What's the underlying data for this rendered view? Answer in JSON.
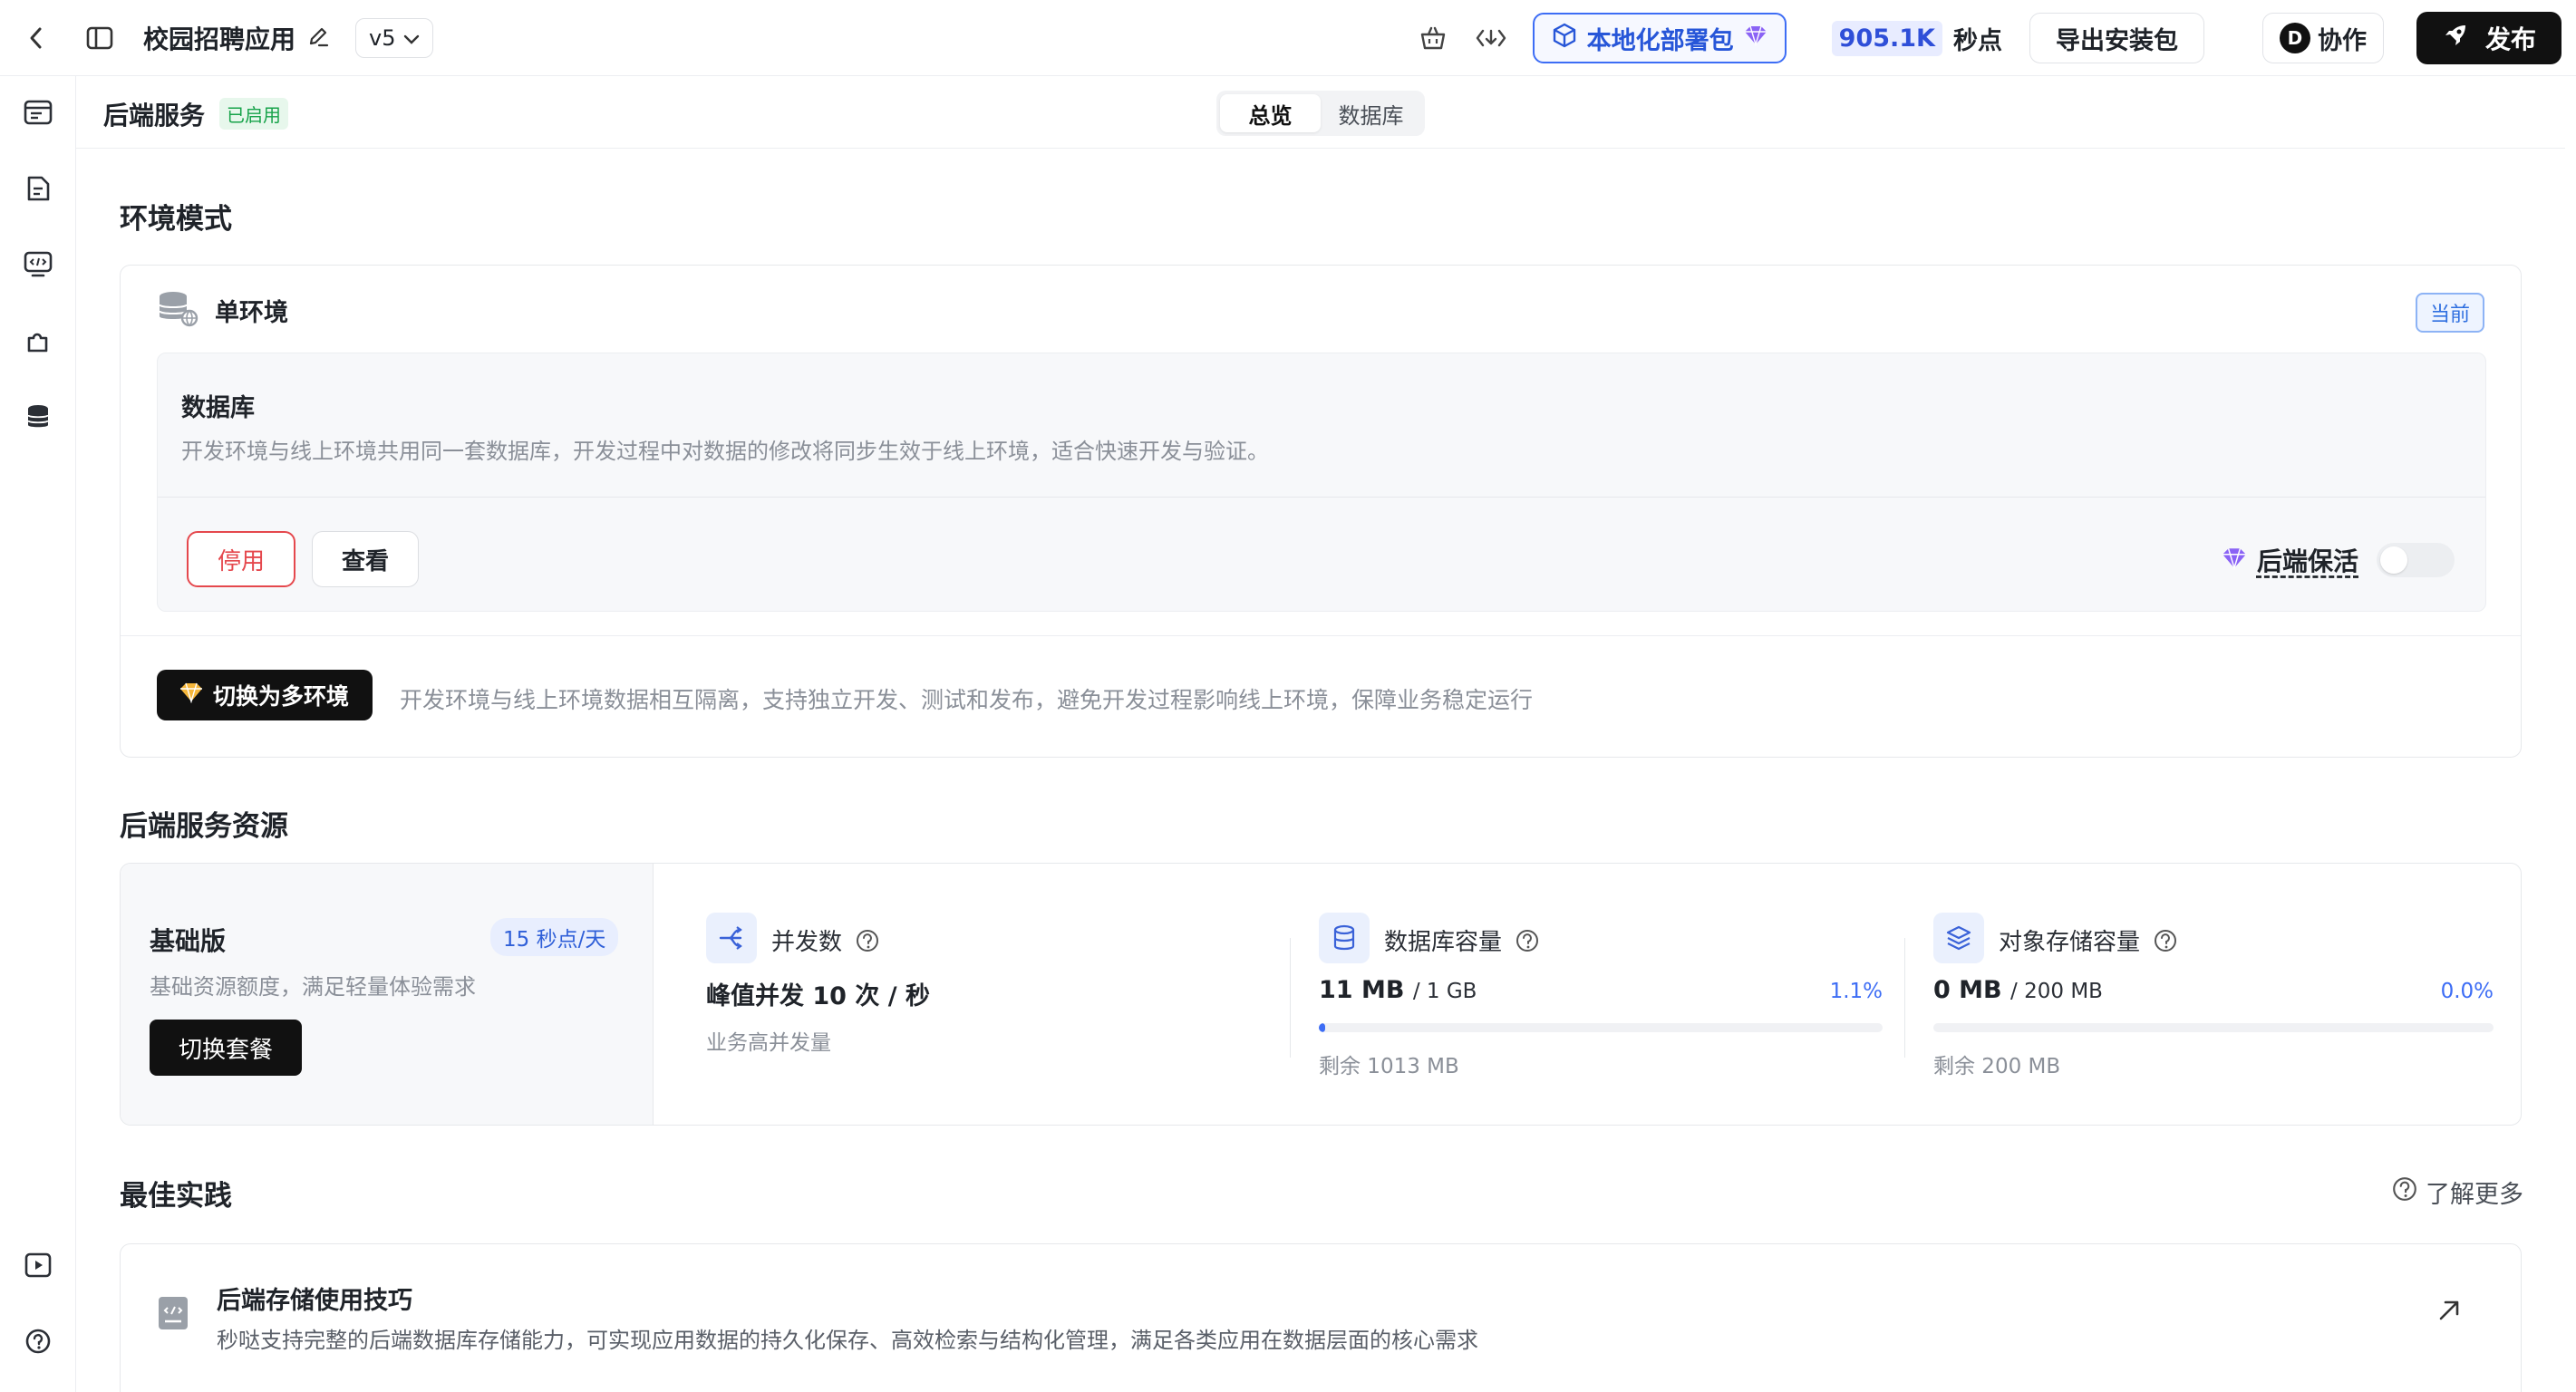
{
  "topbar": {
    "app_title": "校园招聘应用",
    "version": "v5",
    "local_deploy_label": "本地化部署包",
    "points_value": "905.1K",
    "points_unit": "秒点",
    "export_label": "导出安装包",
    "avatar_letter": "D",
    "collab_label": "协作",
    "publish_label": "发布"
  },
  "subheader": {
    "title": "后端服务",
    "status_badge": "已启用",
    "tabs": [
      {
        "label": "总览",
        "active": true
      },
      {
        "label": "数据库",
        "active": false
      }
    ]
  },
  "env": {
    "section_title": "环境模式",
    "mode_name": "单环境",
    "current_tag": "当前",
    "db_title": "数据库",
    "db_desc": "开发环境与线上环境共用同一套数据库，开发过程中对数据的修改将同步生效于线上环境，适合快速开发与验证。",
    "stop_label": "停用",
    "view_label": "查看",
    "keepalive_label": "后端保活",
    "keepalive_on": false,
    "switch_label": "切换为多环境",
    "switch_desc": "开发环境与线上环境数据相互隔离，支持独立开发、测试和发布，避免开发过程影响线上环境，保障业务稳定运行"
  },
  "resources": {
    "section_title": "后端服务资源",
    "plan": {
      "name": "基础版",
      "tag": "15 秒点/天",
      "desc": "基础资源额度，满足轻量体验需求",
      "button": "切换套餐"
    },
    "concurrency": {
      "title": "并发数",
      "value": "峰值并发 10 次 / 秒",
      "sub": "业务高并发量"
    },
    "db_capacity": {
      "title": "数据库容量",
      "used": "11 MB",
      "total": "/ 1 GB",
      "percent_label": "1.1%",
      "percent": 1.1,
      "remaining": "剩余 1013 MB"
    },
    "object_storage": {
      "title": "对象存储容量",
      "used": "0 MB",
      "total": "/ 200 MB",
      "percent_label": "0.0%",
      "percent": 0.0,
      "remaining": "剩余 200 MB"
    }
  },
  "best_practice": {
    "section_title": "最佳实践",
    "learn_more": "了解更多",
    "tip_title": "后端存储使用技巧",
    "tip_desc": "秒哒支持完整的后端数据库存储能力，可实现应用数据的持久化保存、高效检索与结构化管理，满足各类应用在数据层面的核心需求"
  },
  "colors": {
    "accent": "#3d6df5",
    "danger": "#e5484d",
    "success": "#17a34a"
  },
  "icons": {
    "sidebar": [
      "browser-icon",
      "document-icon",
      "code-screen-icon",
      "plugin-icon",
      "database-icon",
      "play-icon",
      "help-icon"
    ]
  }
}
